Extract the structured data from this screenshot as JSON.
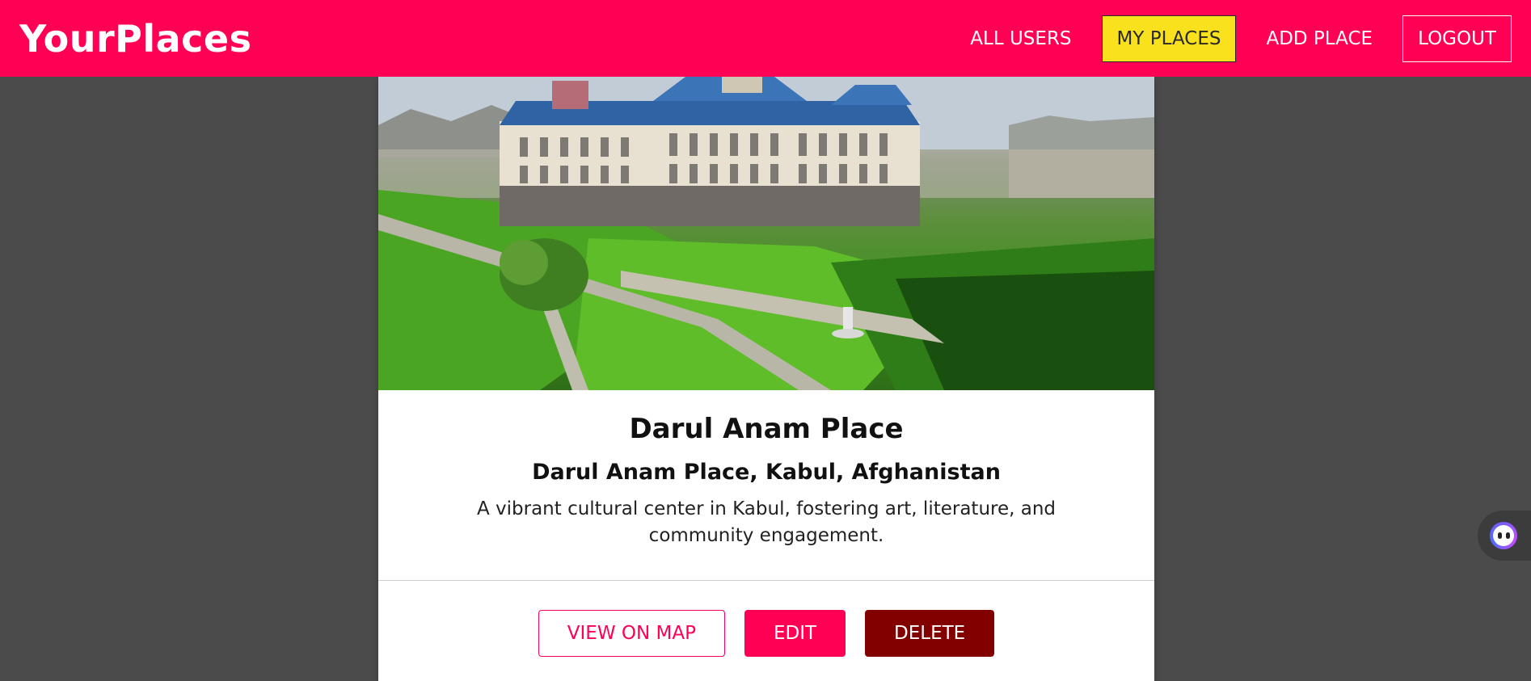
{
  "header": {
    "logo": "YourPlaces",
    "nav": {
      "all_users": "ALL USERS",
      "my_places": "MY PLACES",
      "add_place": "ADD PLACE",
      "logout": "LOGOUT"
    },
    "active_item": "my_places"
  },
  "place": {
    "title": "Darul Anam Place",
    "address": "Darul Anam Place, Kabul, Afghanistan",
    "description": "A vibrant cultural center in Kabul, fostering art, literature, and community engagement.",
    "image_alt": "Darul Anam Place"
  },
  "actions": {
    "view_on_map": "VIEW ON MAP",
    "edit": "EDIT",
    "delete": "DELETE"
  },
  "colors": {
    "brand": "#ff0055",
    "active_nav": "#f9e21d",
    "danger": "#830000",
    "backdrop": "#4b4b4b"
  },
  "icons": {
    "assistant": "assistant-bot-icon"
  }
}
